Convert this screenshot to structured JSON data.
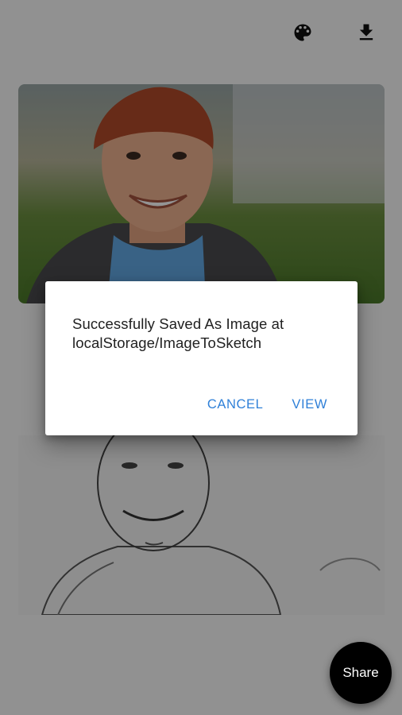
{
  "toolbar": {
    "palette_icon": "palette-icon",
    "download_icon": "download-icon"
  },
  "dialog": {
    "message": "Successfully Saved As Image at localStorage/ImageToSketch",
    "cancel_label": "CANCEL",
    "view_label": "VIEW",
    "accent_color": "#2f80d8"
  },
  "fab": {
    "label": "Share"
  },
  "colors": {
    "scrim": "rgba(0,0,0,0.42)",
    "fab_background": "#000000"
  }
}
